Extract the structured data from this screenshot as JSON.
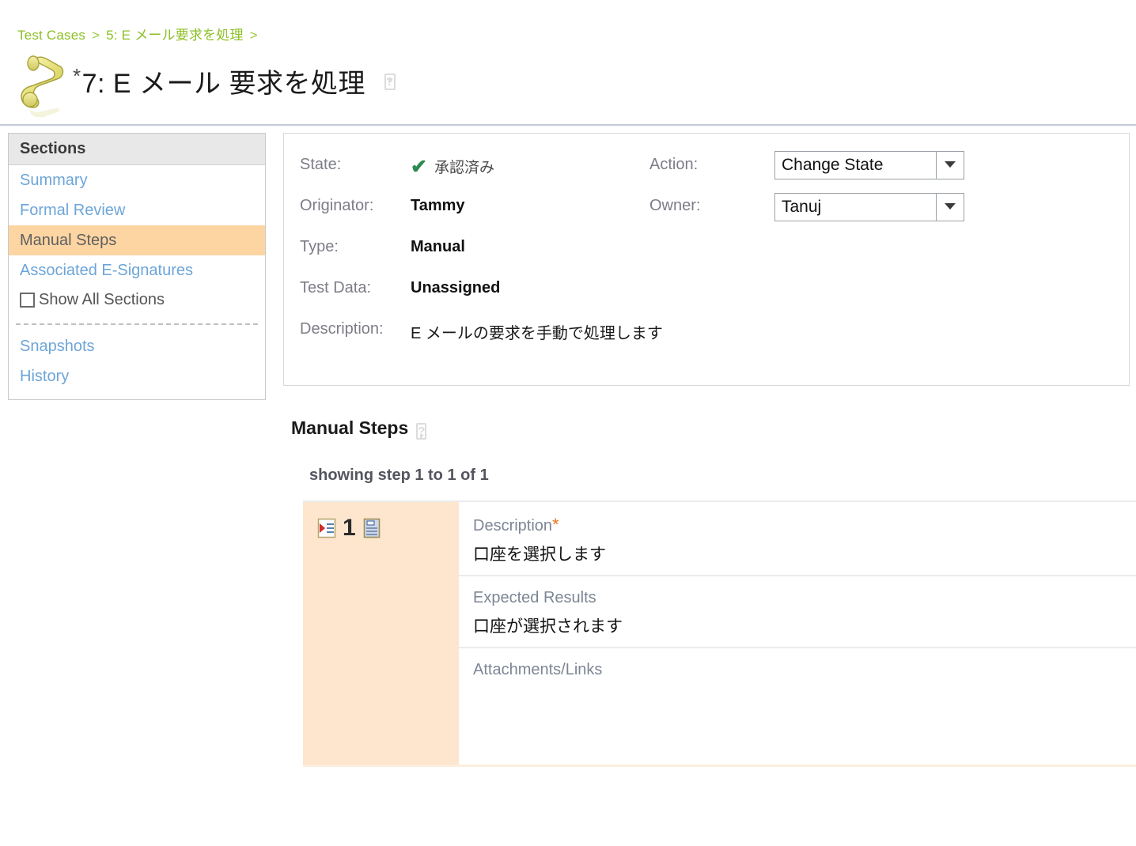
{
  "breadcrumb": {
    "root": "Test Cases",
    "sep": ">",
    "parent": "5: E メール要求を処理",
    "trail": ">"
  },
  "title": {
    "required_marker": "*",
    "text": "7: E メール 要求を処理",
    "icon": "scroll-icon",
    "help": "?"
  },
  "sidebar": {
    "header": "Sections",
    "items": [
      {
        "label": "Summary",
        "active": false
      },
      {
        "label": "Formal Review",
        "active": false
      },
      {
        "label": "Manual Steps",
        "active": true
      },
      {
        "label": "Associated E-Signatures",
        "active": false
      }
    ],
    "show_all": {
      "label": "Show All Sections",
      "checked": false
    },
    "bottom_items": [
      {
        "label": "Snapshots"
      },
      {
        "label": "History"
      }
    ]
  },
  "details": {
    "state": {
      "label": "State:",
      "value": "承認済み",
      "check": "✔"
    },
    "originator": {
      "label": "Originator:",
      "value": "Tammy"
    },
    "type": {
      "label": "Type:",
      "value": "Manual"
    },
    "test_data": {
      "label": "Test Data:",
      "value": "Unassigned"
    },
    "description": {
      "label": "Description:",
      "value": "E メールの要求を手動で処理します"
    },
    "action": {
      "label": "Action:",
      "value": "Change State"
    },
    "owner": {
      "label": "Owner:",
      "value": "Tanuj"
    }
  },
  "manual_steps": {
    "heading": "Manual Steps",
    "help": "?",
    "showing": "showing step 1 to 1 of 1",
    "step": {
      "number": "1",
      "description_label": "Description",
      "description_required": "*",
      "description_value": "口座を選択します",
      "expected_label": "Expected Results",
      "expected_value": "口座が選択されます",
      "attachments_label": "Attachments/Links",
      "attachments_value": ""
    }
  },
  "colors": {
    "breadcrumb_green": "#8cbf26",
    "link_blue": "#6da5d8",
    "active_orange": "#fcd5a2",
    "step_orange": "#fde6cd",
    "required_orange": "#e8761a",
    "check_green": "#2e8b4f"
  }
}
